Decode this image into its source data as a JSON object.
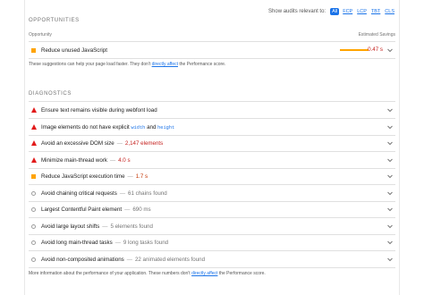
{
  "filter": {
    "label": "Show audits relevant to:",
    "chips": [
      "All",
      "FCP",
      "LCP",
      "TBT",
      "CLS"
    ],
    "active": "All"
  },
  "opportunities": {
    "title": "OPPORTUNITIES",
    "col_left": "Opportunity",
    "col_right": "Estimated Savings",
    "items": [
      {
        "title": "Reduce unused JavaScript",
        "savings": "0.47 s",
        "severity": "average"
      }
    ],
    "note_pre": "These suggestions can help your page load faster. They don't ",
    "note_link": "directly affect",
    "note_post": " the Performance score."
  },
  "diagnostics": {
    "title": "DIAGNOSTICS",
    "items": [
      {
        "title": "Ensure text remains visible during webfont load",
        "severity": "fail"
      },
      {
        "title_pre": "Image elements do not have explicit ",
        "code1": "width",
        "mid": " and ",
        "code2": "height",
        "severity": "fail"
      },
      {
        "title": "Avoid an excessive DOM size",
        "display": "2,147 elements",
        "severity": "fail"
      },
      {
        "title": "Minimize main-thread work",
        "display": "4.0 s",
        "severity": "fail"
      },
      {
        "title": "Reduce JavaScript execution time",
        "display": "1.7 s",
        "severity": "average"
      },
      {
        "title": "Avoid chaining critical requests",
        "display": "61 chains found",
        "severity": "pass"
      },
      {
        "title": "Largest Contentful Paint element",
        "display": "690 ms",
        "severity": "pass"
      },
      {
        "title": "Avoid large layout shifts",
        "display": "5 elements found",
        "severity": "pass"
      },
      {
        "title": "Avoid long main-thread tasks",
        "display": "9 long tasks found",
        "severity": "pass"
      },
      {
        "title": "Avoid non-composited animations",
        "display": "22 animated elements found",
        "severity": "pass"
      }
    ],
    "note_pre": "More information about the performance of your application. These numbers don't ",
    "note_link": "directly affect",
    "note_post": " the Performance score."
  },
  "separator": "—",
  "icons": {
    "fail": "red-triangle-icon",
    "average": "orange-square-icon",
    "pass": "gray-circle-icon",
    "expand": "chevron-down-icon"
  },
  "colors": {
    "fail": "#e21b1b",
    "average": "#ffa400",
    "pass": "#9e9e9e",
    "link": "#1a73e8"
  }
}
